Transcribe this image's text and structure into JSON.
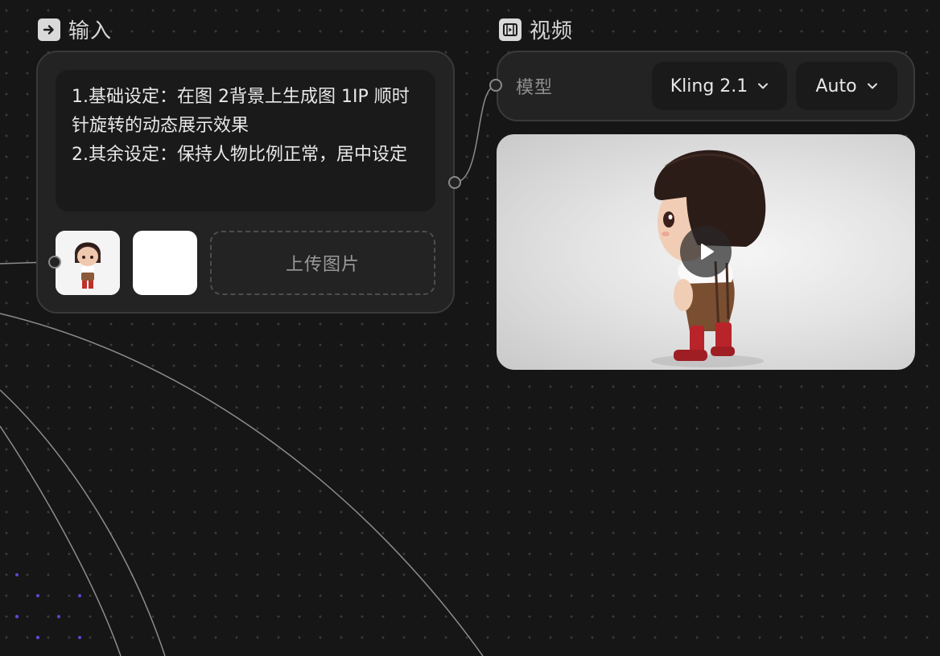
{
  "input_node": {
    "title": "输入",
    "icon": "arrow-in-icon",
    "prompt_text": "1.基础设定：在图 2背景上生成图 1IP 顺时针旋转的动态展示效果\n2.其余设定：保持人物比例正常，居中设定",
    "upload_label": "上传图片"
  },
  "video_node": {
    "title": "视频",
    "icon": "film-icon",
    "model_label": "模型",
    "model_value": "Kling 2.1",
    "ratio_value": "Auto"
  },
  "colors": {
    "background": "#161616",
    "card": "#232323",
    "accent_dots": "#5a4ad0"
  }
}
